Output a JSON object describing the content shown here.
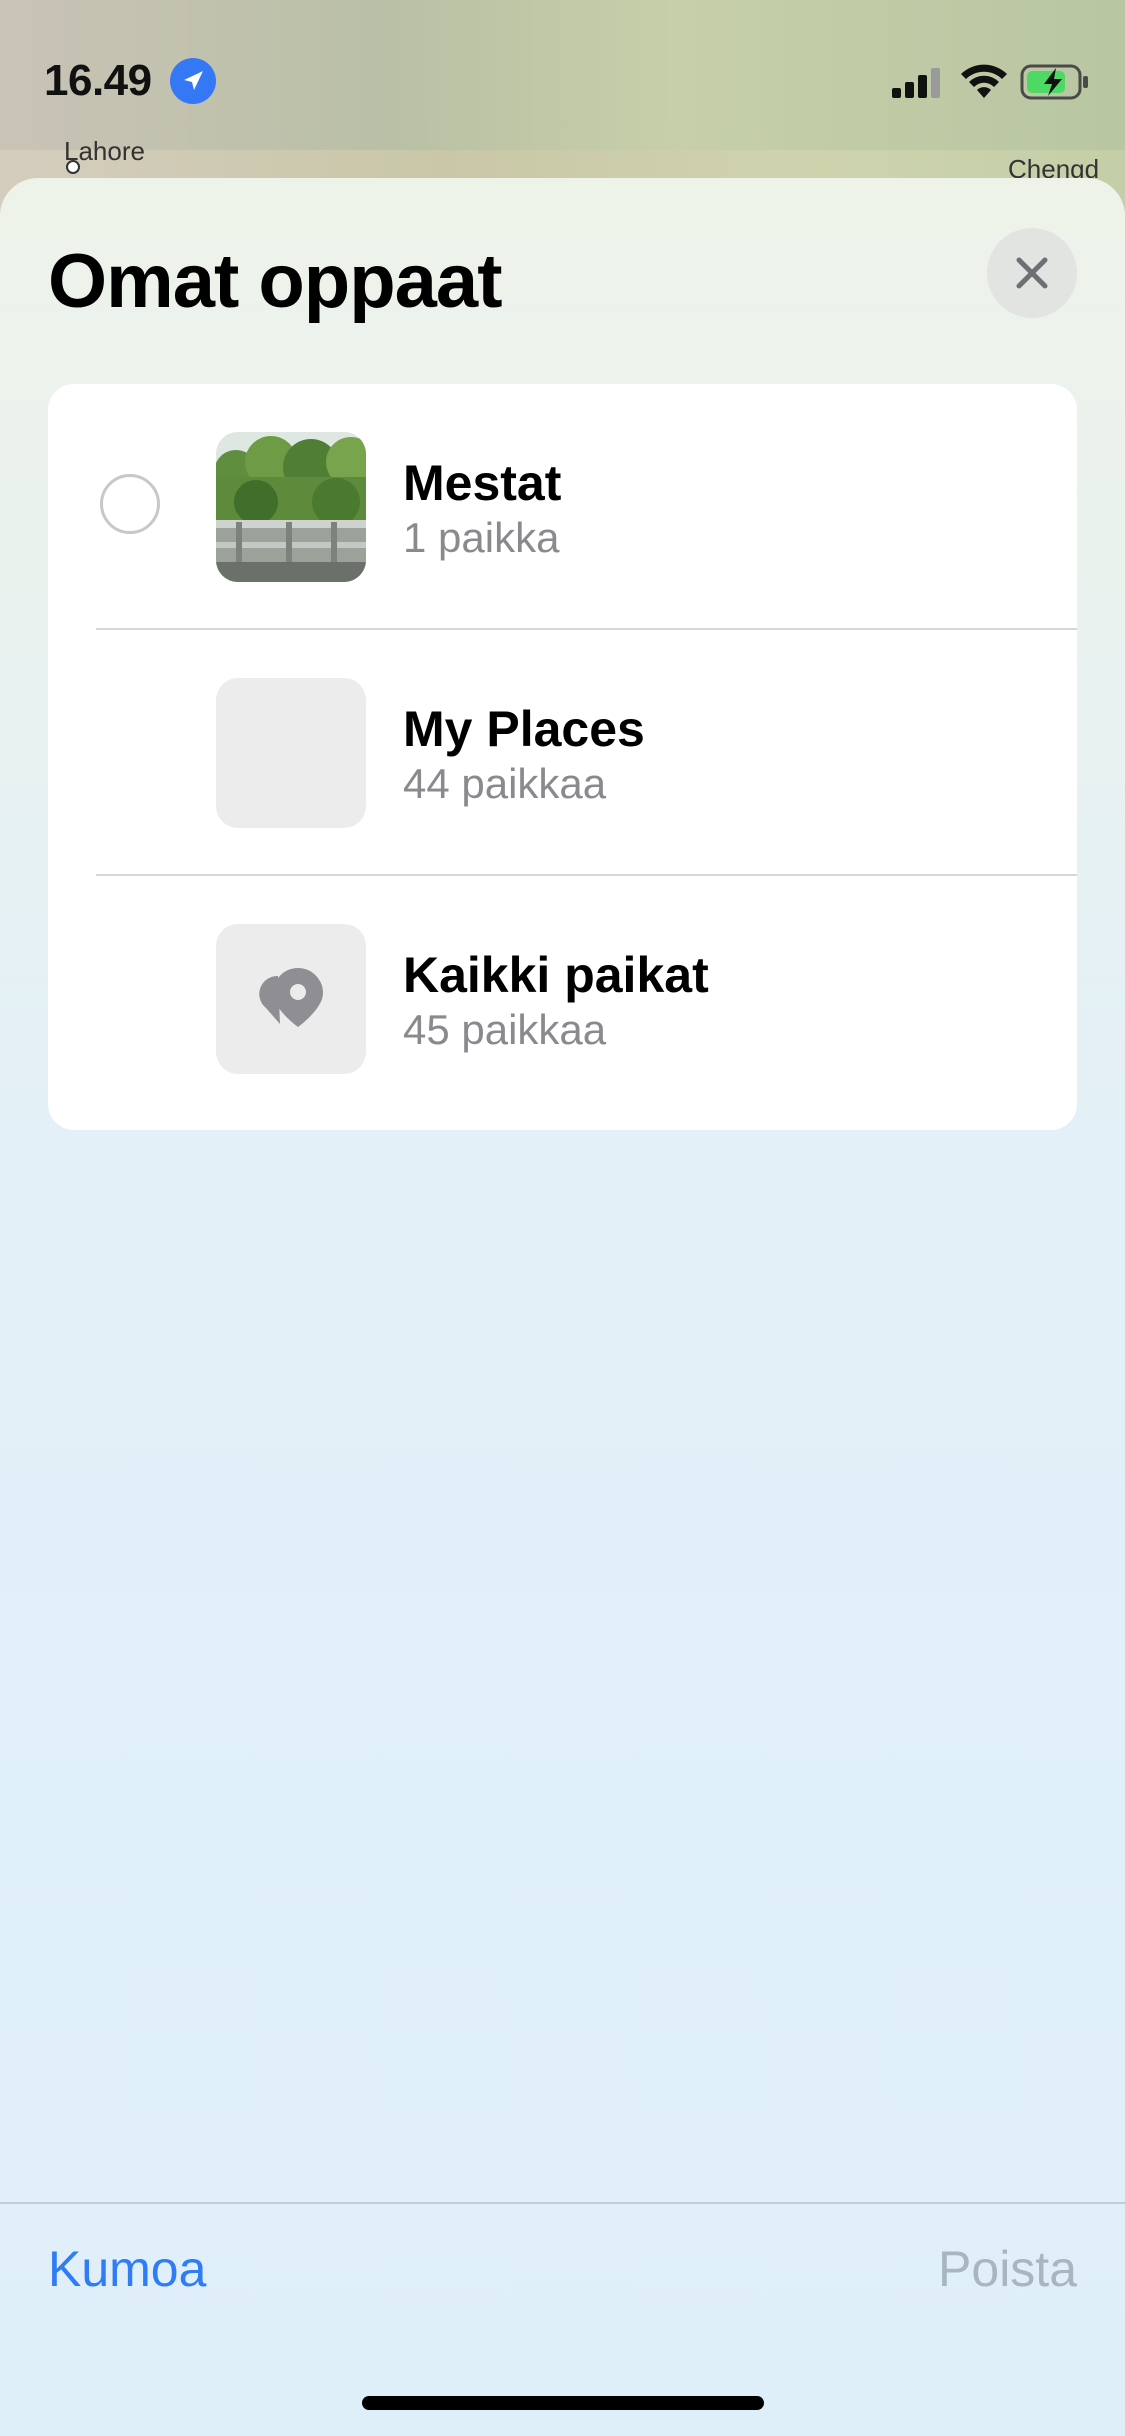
{
  "status_bar": {
    "time": "16.49",
    "location_icon": "location-arrow-icon",
    "signal_icon": "cellular-signal-icon",
    "wifi_icon": "wifi-icon",
    "battery_icon": "battery-charging-icon",
    "battery_color": "#4cd964"
  },
  "map": {
    "labels": [
      "Lahore",
      "Chengd"
    ]
  },
  "sheet": {
    "title": "Omat oppaat",
    "close_icon": "close-icon",
    "guides": [
      {
        "title": "Mestat",
        "subtitle": "1 paikka",
        "thumbnail": "photo-thumbnail",
        "selectable": true
      },
      {
        "title": "My Places",
        "subtitle": "44 paikkaa",
        "thumbnail": "empty-thumbnail",
        "selectable": false
      },
      {
        "title": "Kaikki paikat",
        "subtitle": "45 paikkaa",
        "thumbnail": "map-pin-icon",
        "selectable": false
      }
    ]
  },
  "toolbar": {
    "undo_label": "Kumoa",
    "delete_label": "Poista"
  },
  "colors": {
    "accent": "#2f7cf6",
    "disabled": "#a9b5c0"
  }
}
